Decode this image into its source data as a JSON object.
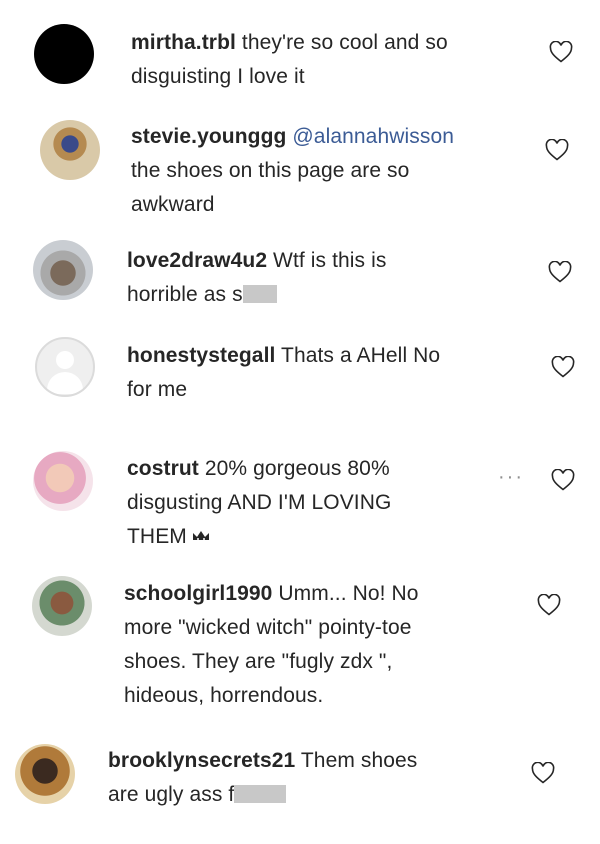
{
  "comments": [
    {
      "username": "mirtha.trbl",
      "text": "they're so cool and so",
      "line2": "disguisting I love it"
    },
    {
      "username": "stevie.younggg",
      "mention": "@alannahwisson",
      "line2": "the shoes on this page are so",
      "line3": "awkward"
    },
    {
      "username": "love2draw4u2",
      "text": "Wtf is this is",
      "line2": "horrible as s"
    },
    {
      "username": "honestystegall",
      "text": "Thats a AHell No",
      "line2": "for me"
    },
    {
      "username": "costrut",
      "text": "20% gorgeous 80%",
      "line2": "disgusting AND I'M LOVING",
      "line3": "THEM",
      "more": "···"
    },
    {
      "username": "schoolgirl1990",
      "text": "Umm... No! No",
      "line2": "more \"wicked witch\" pointy-toe",
      "line3": "shoes. They are \"fugly zdx \",",
      "line4": "hideous, horrendous."
    },
    {
      "username": "brooklynsecrets21",
      "text": "Them shoes",
      "line2": "are ugly ass f"
    }
  ],
  "icons": {
    "like": "heart-icon",
    "crown": "crown-icon",
    "more": "more-options-icon"
  },
  "colors": {
    "text": "#262626",
    "mention": "#3b5b95",
    "icon": "#262626"
  }
}
